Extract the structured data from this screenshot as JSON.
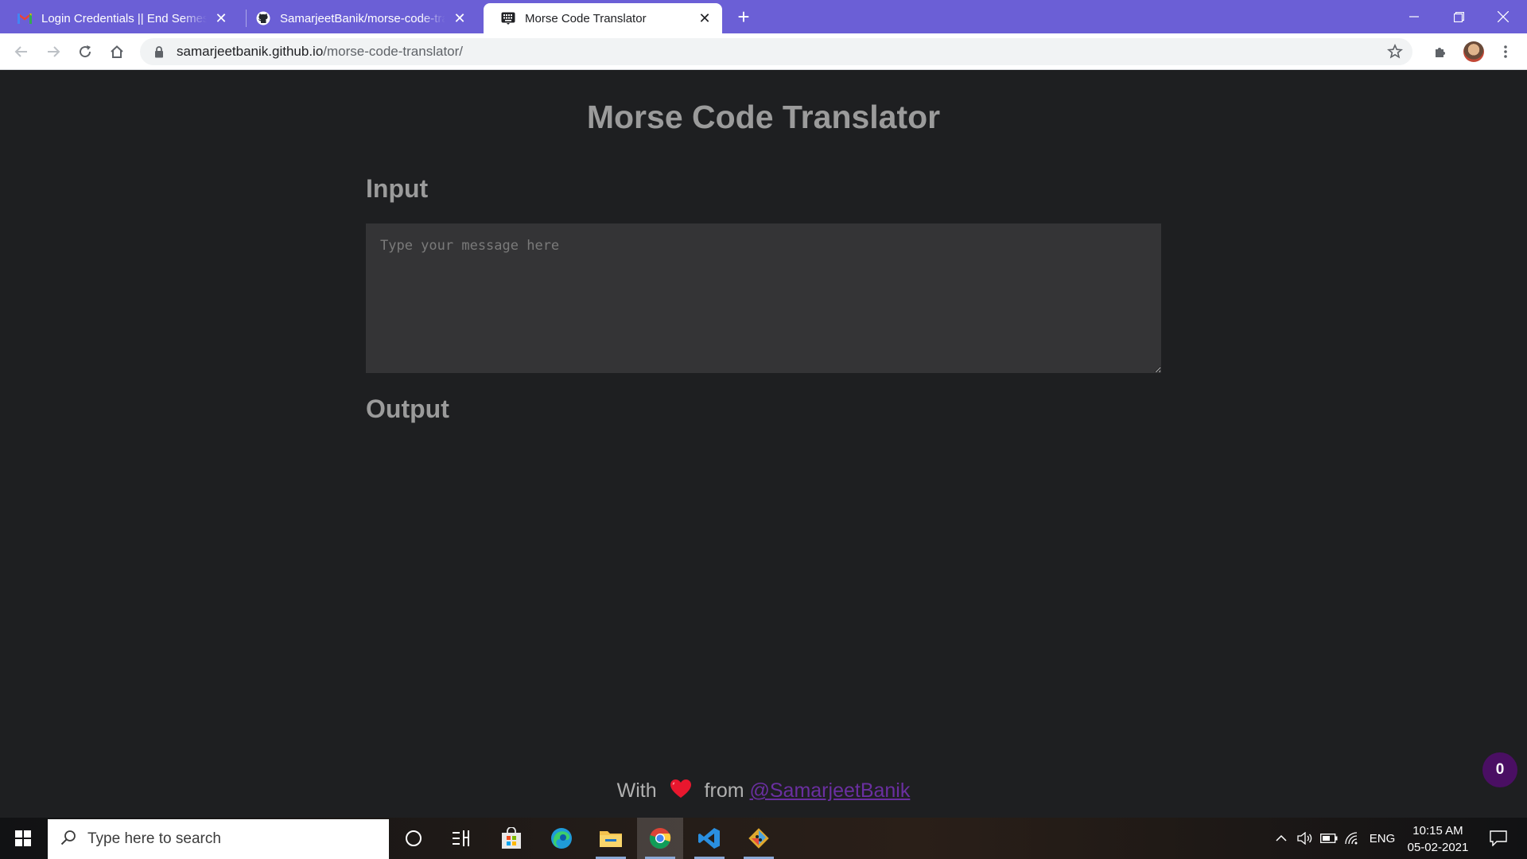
{
  "browser": {
    "tabs": [
      {
        "title": "Login Credentials || End Semeste",
        "icon": "gmail-icon",
        "active": false
      },
      {
        "title": "SamarjeetBanik/morse-code-tran",
        "icon": "github-icon",
        "active": false
      },
      {
        "title": "Morse Code Translator",
        "icon": "keyboard-icon",
        "active": true
      }
    ],
    "address": {
      "host": "samarjeetbanik.github.io",
      "path": "/morse-code-translator/"
    }
  },
  "page": {
    "title": "Morse Code Translator",
    "input_heading": "Input",
    "input_placeholder": "Type your message here",
    "input_value": "",
    "output_heading": "Output",
    "output_value": "",
    "footer": {
      "prefix": "With",
      "middle": "from",
      "link": "@SamarjeetBanik"
    },
    "counter": "0"
  },
  "taskbar": {
    "search_placeholder": "Type here to search",
    "apps": [
      "cortana-icon",
      "task-view-icon",
      "store-icon",
      "edge-icon",
      "file-explorer-icon",
      "chrome-icon",
      "vscode-icon",
      "git-icon"
    ],
    "tray": {
      "language": "ENG",
      "time": "10:15 AM",
      "date": "05-02-2021"
    }
  },
  "colors": {
    "tabstrip": "#6b5fd6",
    "page_bg": "#1e1f21",
    "heading": "#9b9b9b",
    "textarea_bg": "#343436",
    "link": "#6a2fa0",
    "counter_bg": "#4a0f63"
  }
}
